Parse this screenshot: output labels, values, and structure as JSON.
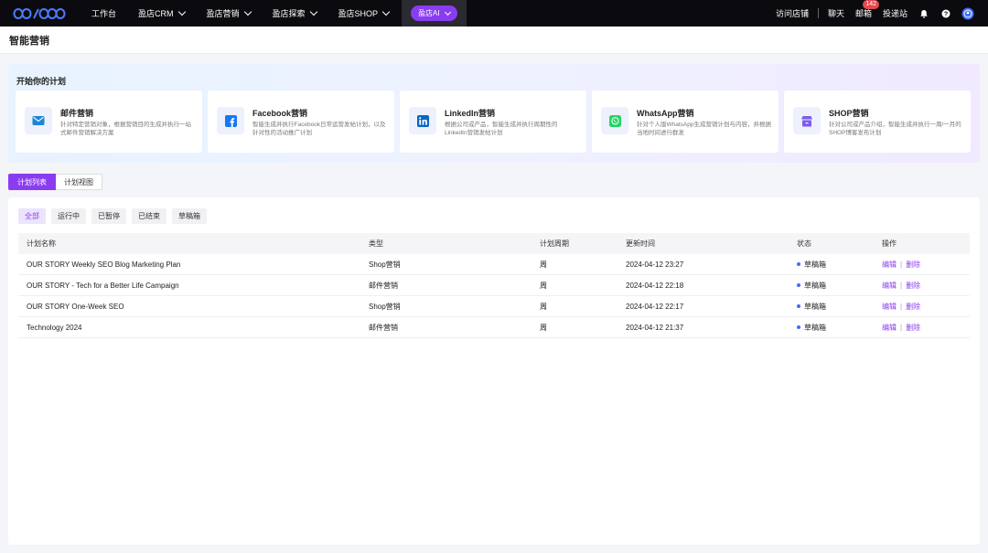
{
  "nav": {
    "items": [
      {
        "label": "工作台",
        "has_dropdown": false
      },
      {
        "label": "盈店CRM",
        "has_dropdown": true
      },
      {
        "label": "盈店营销",
        "has_dropdown": true
      },
      {
        "label": "盈店探索",
        "has_dropdown": true
      },
      {
        "label": "盈店SHOP",
        "has_dropdown": true
      }
    ],
    "ai_label": "盈店AI",
    "right": {
      "visit_store": "访问店铺",
      "chat": "聊天",
      "mailbox": "邮箱",
      "mail_badge": "142",
      "delivery": "投递站"
    }
  },
  "page": {
    "title": "智能营销"
  },
  "start": {
    "title": "开始你的计划",
    "cards": [
      {
        "title": "邮件营销",
        "desc": "针对特定营销对象，根据营销目的生成并执行一站式邮件营销解决方案",
        "icon": "mail-icon"
      },
      {
        "title": "Facebook营销",
        "desc": "智能生成并执行Facebook日常运营发帖计划，以及针对性的活动推广计划",
        "icon": "facebook-icon"
      },
      {
        "title": "LinkedIn营销",
        "desc": "根据公司或产品，智能生成并执行周期性的LinkedIn营销发帖计划",
        "icon": "linkedin-icon"
      },
      {
        "title": "WhatsApp营销",
        "desc": "针对个人版WhatsApp生成营销计划与内容，并根据当地时间进行群发",
        "icon": "whatsapp-icon"
      },
      {
        "title": "SHOP营销",
        "desc": "针对公司或产品介绍，智能生成并执行一周/一月的SHOP博客发布计划",
        "icon": "shop-icon"
      }
    ]
  },
  "tabs": [
    {
      "label": "计划列表",
      "active": true
    },
    {
      "label": "计划视图",
      "active": false
    }
  ],
  "filters": [
    {
      "label": "全部",
      "active": true
    },
    {
      "label": "运行中",
      "active": false
    },
    {
      "label": "已暂停",
      "active": false
    },
    {
      "label": "已结束",
      "active": false
    },
    {
      "label": "草稿箱",
      "active": false
    }
  ],
  "table": {
    "headers": [
      "计划名称",
      "类型",
      "计划周期",
      "更新时间",
      "状态",
      "操作"
    ],
    "rows": [
      {
        "name": "OUR STORY Weekly SEO Blog Marketing Plan",
        "type": "Shop营销",
        "period": "周",
        "updated": "2024-04-12 23:27",
        "status": "草稿箱"
      },
      {
        "name": "OUR STORY - Tech for a Better Life Campaign",
        "type": "邮件营销",
        "period": "周",
        "updated": "2024-04-12 22:18",
        "status": "草稿箱"
      },
      {
        "name": "OUR STORY One-Week SEO",
        "type": "Shop营销",
        "period": "周",
        "updated": "2024-04-12 22:17",
        "status": "草稿箱"
      },
      {
        "name": "Technology 2024",
        "type": "邮件营销",
        "period": "周",
        "updated": "2024-04-12 21:37",
        "status": "草稿箱"
      }
    ],
    "edit_label": "编辑",
    "delete_label": "删除"
  },
  "colors": {
    "accent": "#8a3df0",
    "status_dot": "#3d6df5",
    "nav_bg": "#0b0b0f"
  }
}
